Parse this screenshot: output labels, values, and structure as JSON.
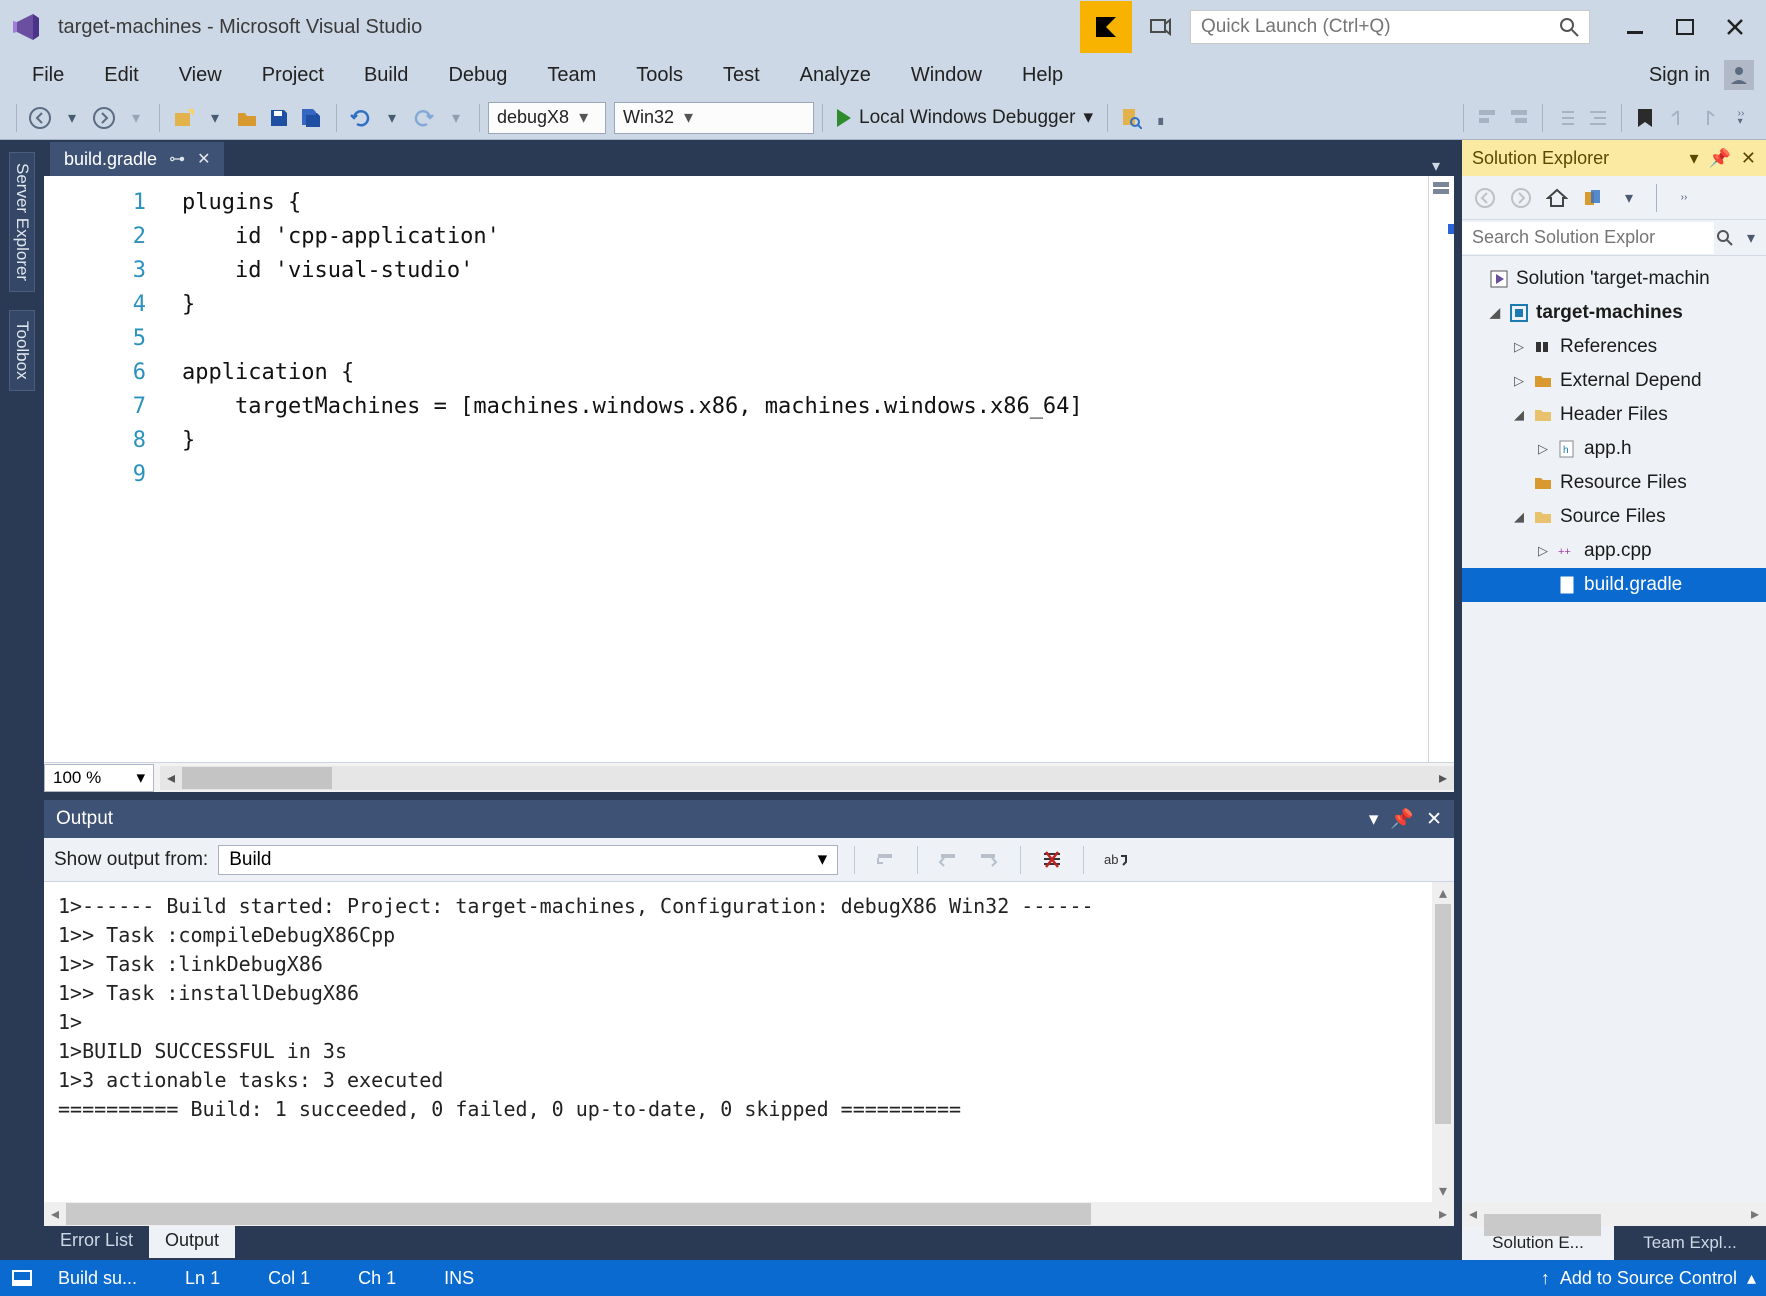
{
  "title": "target-machines - Microsoft Visual Studio",
  "quick_launch_placeholder": "Quick Launch (Ctrl+Q)",
  "signin": "Sign in",
  "menu": [
    "File",
    "Edit",
    "View",
    "Project",
    "Build",
    "Debug",
    "Team",
    "Tools",
    "Test",
    "Analyze",
    "Window",
    "Help"
  ],
  "toolbar": {
    "config": "debugX8",
    "platform": "Win32",
    "run_label": "Local Windows Debugger"
  },
  "left_wells": [
    "Server Explorer",
    "Toolbox"
  ],
  "document_tab": {
    "name": "build.gradle"
  },
  "editor": {
    "zoom": "100 %",
    "lines": [
      "plugins {",
      "    id 'cpp-application'",
      "    id 'visual-studio'",
      "}",
      "",
      "application {",
      "    targetMachines = [machines.windows.x86, machines.windows.x86_64]",
      "}",
      ""
    ]
  },
  "output": {
    "panel_title": "Output",
    "from_label": "Show output from:",
    "from_value": "Build",
    "text": "1>------ Build started: Project: target-machines, Configuration: debugX86 Win32 ------\n1>> Task :compileDebugX86Cpp\n1>> Task :linkDebugX86\n1>> Task :installDebugX86\n1>\n1>BUILD SUCCESSFUL in 3s\n1>3 actionable tasks: 3 executed\n========== Build: 1 succeeded, 0 failed, 0 up-to-date, 0 skipped =========="
  },
  "bottom_tabs": {
    "error_list": "Error List",
    "output": "Output"
  },
  "solution_explorer": {
    "title": "Solution Explorer",
    "search_placeholder": "Search Solution Explor",
    "solution_node": "Solution 'target-machin",
    "project": "target-machines",
    "references": "References",
    "external_deps": "External Depend",
    "header_files": "Header Files",
    "app_h": "app.h",
    "resource_files": "Resource Files",
    "source_files": "Source Files",
    "app_cpp": "app.cpp",
    "build_gradle": "build.gradle",
    "tab_solution": "Solution E...",
    "tab_team": "Team Expl..."
  },
  "status": {
    "build": "Build su...",
    "ln": "Ln 1",
    "col": "Col 1",
    "ch": "Ch 1",
    "ins": "INS",
    "scc": "Add to Source Control"
  }
}
